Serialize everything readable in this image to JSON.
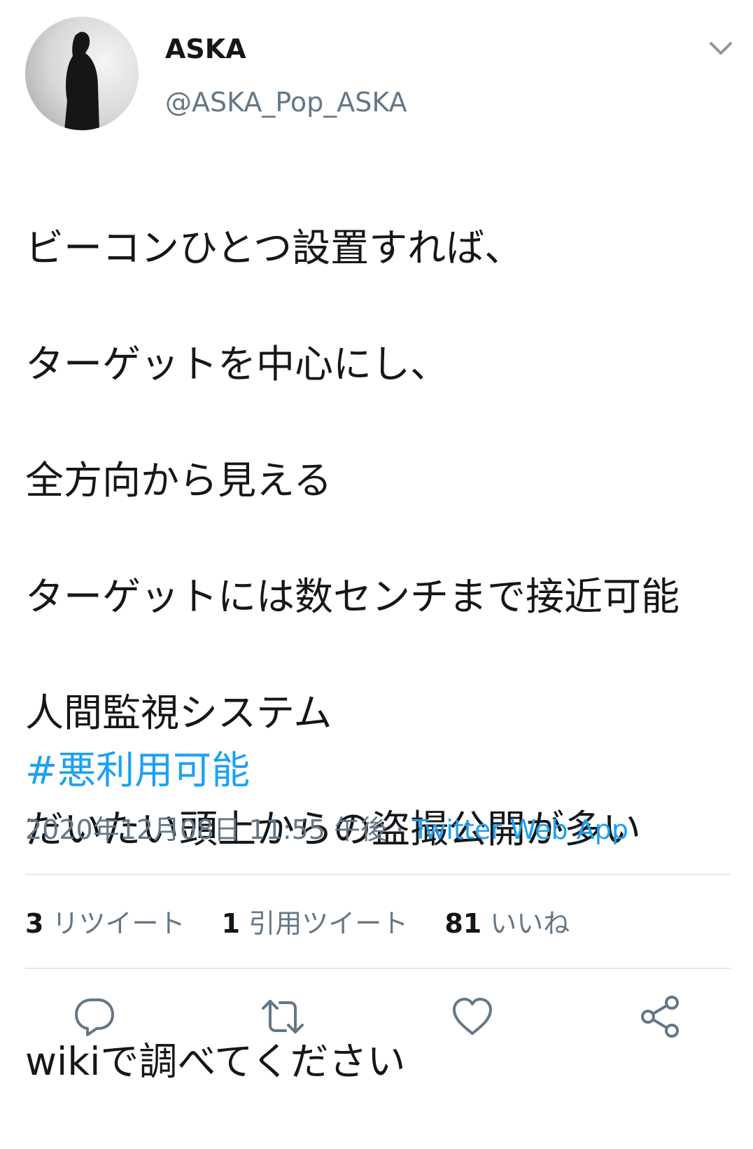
{
  "tweet": {
    "author": {
      "display_name": "ASKA",
      "handle": "@ASKA_Pop_ASKA"
    },
    "text_lines": [
      "ビーコンひとつ設置すれば、",
      "ターゲットを中心にし、",
      "全方向から見える",
      "ターゲットには数センチまで接近可能",
      "人間監視システム",
      "だいたい頭上からの盗撮公開が多い",
      "",
      "wikiで調べてください"
    ],
    "hashtag": "#悪利用可能",
    "timestamp": "2020年12月08日 11:55 午後",
    "separator": " · ",
    "source": "Twitter Web App"
  },
  "stats": {
    "retweets_count": "3",
    "retweets_label": "リツイート",
    "quotes_count": "1",
    "quotes_label": "引用ツイート",
    "likes_count": "81",
    "likes_label": "いいね"
  },
  "icons": {
    "more": "chevron-down-icon",
    "reply": "reply-icon",
    "retweet": "retweet-icon",
    "like": "heart-icon",
    "share": "share-icon"
  },
  "colors": {
    "link": "#1da1f2",
    "secondary_text": "#657786",
    "icon": "#657786",
    "divider": "#e1e8ed"
  }
}
